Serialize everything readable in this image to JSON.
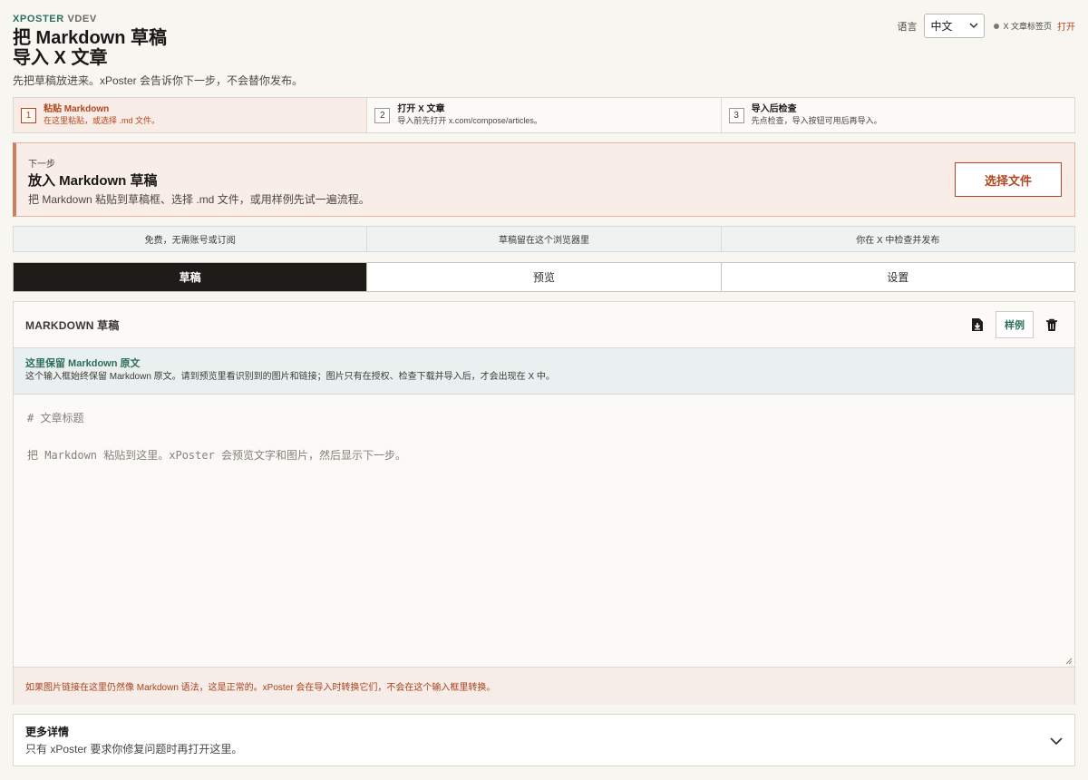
{
  "brand": {
    "name": "XPOSTER",
    "version": "VDEV"
  },
  "title": "把 Markdown 草稿导入 X 文章",
  "subtitle": "先把草稿放进来。xPoster 会告诉你下一步，不会替你发布。",
  "language": {
    "label": "语言",
    "selected": "中文"
  },
  "x_status": {
    "text": "X 文章标签页",
    "link": "打开"
  },
  "steps": [
    {
      "num": "1",
      "title": "粘贴 Markdown",
      "desc": "在这里粘贴，或选择 .md 文件。",
      "active": true
    },
    {
      "num": "2",
      "title": "打开 X 文章",
      "desc": "导入前先打开 x.com/compose/articles。",
      "active": false
    },
    {
      "num": "3",
      "title": "导入后检查",
      "desc": "先点检查，导入按钮可用后再导入。",
      "active": false
    }
  ],
  "next": {
    "label": "下一步",
    "title": "放入 Markdown 草稿",
    "desc": "把 Markdown 粘贴到草稿框、选择 .md 文件，或用样例先试一遍流程。",
    "button": "选择文件"
  },
  "features": [
    "免费，无需账号或订阅",
    "草稿留在这个浏览器里",
    "你在 X 中检查并发布"
  ],
  "tabs": [
    {
      "label": "草稿",
      "active": true
    },
    {
      "label": "预览",
      "active": false
    },
    {
      "label": "设置",
      "active": false
    }
  ],
  "panel": {
    "title": "MARKDOWN 草稿",
    "sample_button": "样例",
    "info_title": "这里保留 Markdown 原文",
    "info_desc": "这个输入框始终保留 Markdown 原文。请到预览里看识别到的图片和链接；图片只有在授权、检查下载并导入后，才会出现在 X 中。",
    "editor_line1": "# 文章标题",
    "editor_line2": "把 Markdown 粘贴到这里。xPoster 会预览文字和图片，然后显示下一步。",
    "warning": "如果图片链接在这里仍然像 Markdown 语法，这是正常的。xPoster 会在导入时转换它们，不会在这个输入框里转换。"
  },
  "details": {
    "title": "更多详情",
    "desc": "只有 xPoster 要求你修复问题时再打开这里。"
  },
  "colors": {
    "accent": "#b1471e",
    "brand": "#2c6e5c",
    "tab_active": "#1e1c19"
  }
}
